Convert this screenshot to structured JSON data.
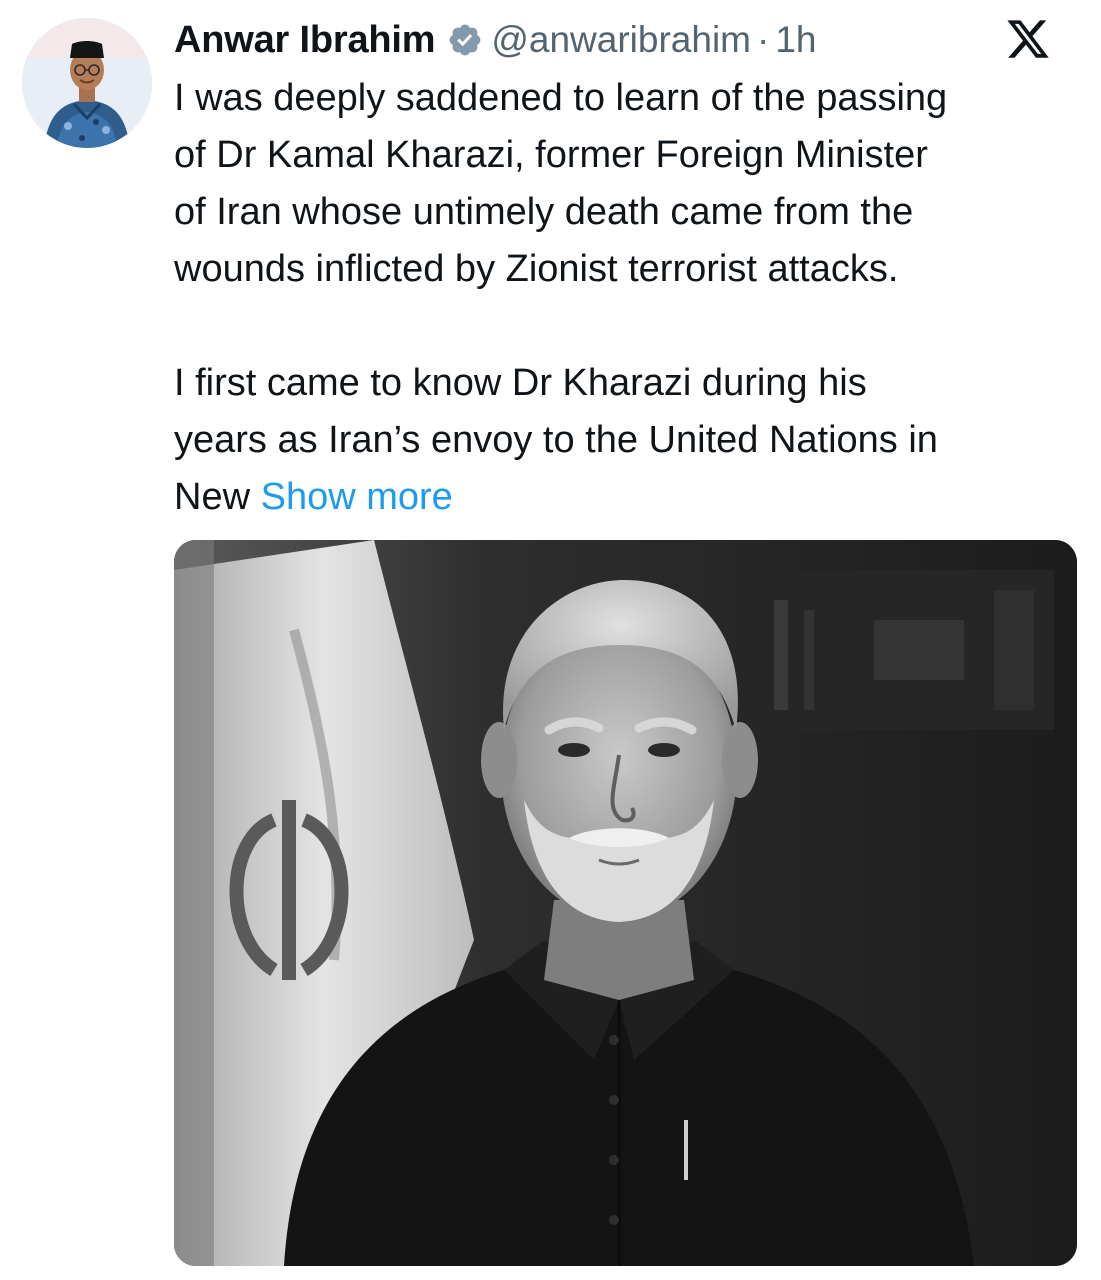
{
  "tweet": {
    "author": {
      "display_name": "Anwar Ibrahim",
      "handle": "@anwaribrahim",
      "separator": "·",
      "time": "1h",
      "verified_icon": "verified-badge-icon"
    },
    "platform_icon": "x-logo-icon",
    "paragraphs": [
      [
        "I was deeply saddened to learn of the passing",
        "of Dr Kamal Kharazi, former Foreign Minister",
        "of Iran whose untimely death came from the",
        "wounds inflicted by Zionist terrorist attacks."
      ],
      [
        "I first came to know Dr Kharazi during his",
        "years as Iran’s envoy to the United Nations in"
      ]
    ],
    "truncated_line": "New",
    "show_more": "Show more",
    "colors": {
      "text": "#0f1419",
      "secondary": "#536471",
      "link": "#1d9bf0",
      "verified_badge": "#829aab"
    }
  }
}
